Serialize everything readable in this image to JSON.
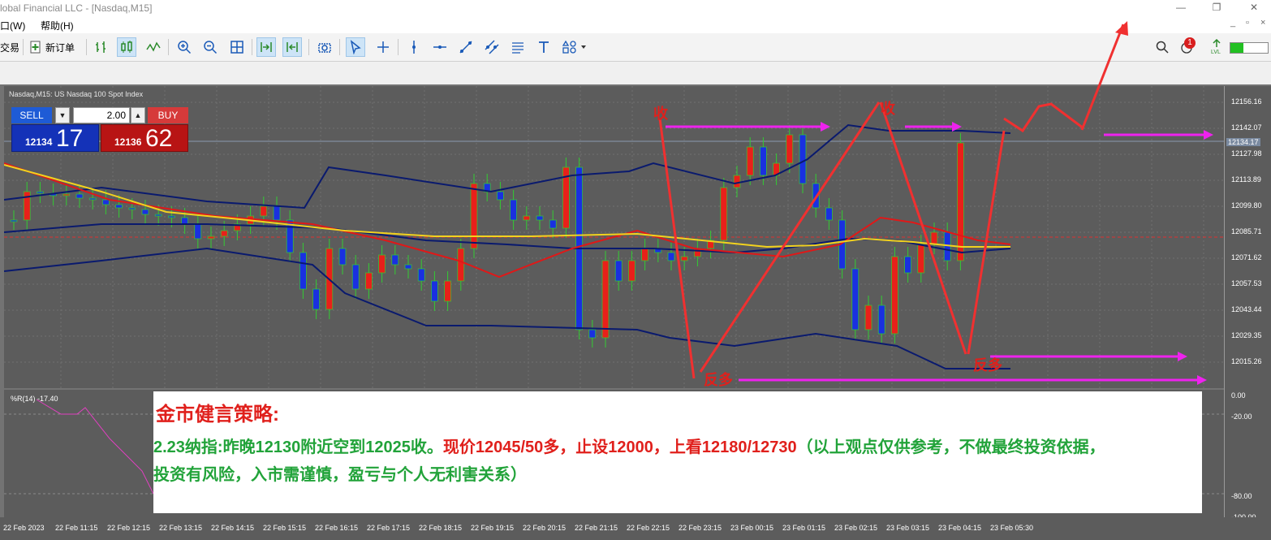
{
  "window": {
    "title": "lobal Financial LLC - [Nasdaq,M15]",
    "minimize": "—",
    "restore": "❐",
    "close": "✕"
  },
  "menu": {
    "items": [
      "口(W)",
      "帮助(H)"
    ],
    "mdi_minimize": "_",
    "mdi_restore": "▫",
    "mdi_close": "×"
  },
  "toolbar": {
    "trade_label": "交易",
    "new_order_label": "新订单",
    "notification_count": "1"
  },
  "symbol": {
    "label": "Nasdaq,M15:  US Nasdaq 100 Spot Index"
  },
  "trade_panel": {
    "sell_label": "SELL",
    "buy_label": "BUY",
    "lot": "2.00",
    "sell_prefix": "12134",
    "sell_big": "17",
    "buy_prefix": "12136",
    "buy_big": "62"
  },
  "price_axis": {
    "labels": [
      "12156.16",
      "12142.07",
      "12127.98",
      "12113.89",
      "12099.80",
      "12085.71",
      "12071.62",
      "12057.53",
      "12043.44",
      "12029.35",
      "12015.26"
    ],
    "current_price": "12134.17"
  },
  "indicator": {
    "label": "%R(14) -17.40",
    "levels": [
      "0.00",
      "-20.00",
      "-80.00",
      "-100.00"
    ]
  },
  "time_axis": {
    "labels": [
      "22 Feb 2023",
      "22 Feb 11:15",
      "22 Feb 12:15",
      "22 Feb 13:15",
      "22 Feb 14:15",
      "22 Feb 15:15",
      "22 Feb 16:15",
      "22 Feb 17:15",
      "22 Feb 18:15",
      "22 Feb 19:15",
      "22 Feb 20:15",
      "22 Feb 21:15",
      "22 Feb 22:15",
      "22 Feb 23:15",
      "23 Feb 00:15",
      "23 Feb 01:15",
      "23 Feb 02:15",
      "23 Feb 03:15",
      "23 Feb 04:15",
      "23 Feb 05:30"
    ]
  },
  "annotations": {
    "close1": "收",
    "close2": "收",
    "reverse1": "反多",
    "reverse2": "反多"
  },
  "strategy": {
    "title": "金市健言策略:",
    "line1_green": "2.23纳指:昨晚12130附近空到12025收。",
    "line1_red": "现价12045/50多，止设12000，上看12180/12730",
    "line1_green2": "（以上观点仅供参考，不做最终投资依据，",
    "line2": "投资有风险，入市需谨慎，盈亏与个人无利害关系）"
  },
  "colors": {
    "bull": "#e8201a",
    "bear": "#1a30e0",
    "wick": "#33cc33",
    "bollinger": "#0a1a6e",
    "ma_red": "#e01818",
    "ma_yellow": "#f2d21e",
    "arrow": "#f03030",
    "magenta": "#ee22ee"
  }
}
